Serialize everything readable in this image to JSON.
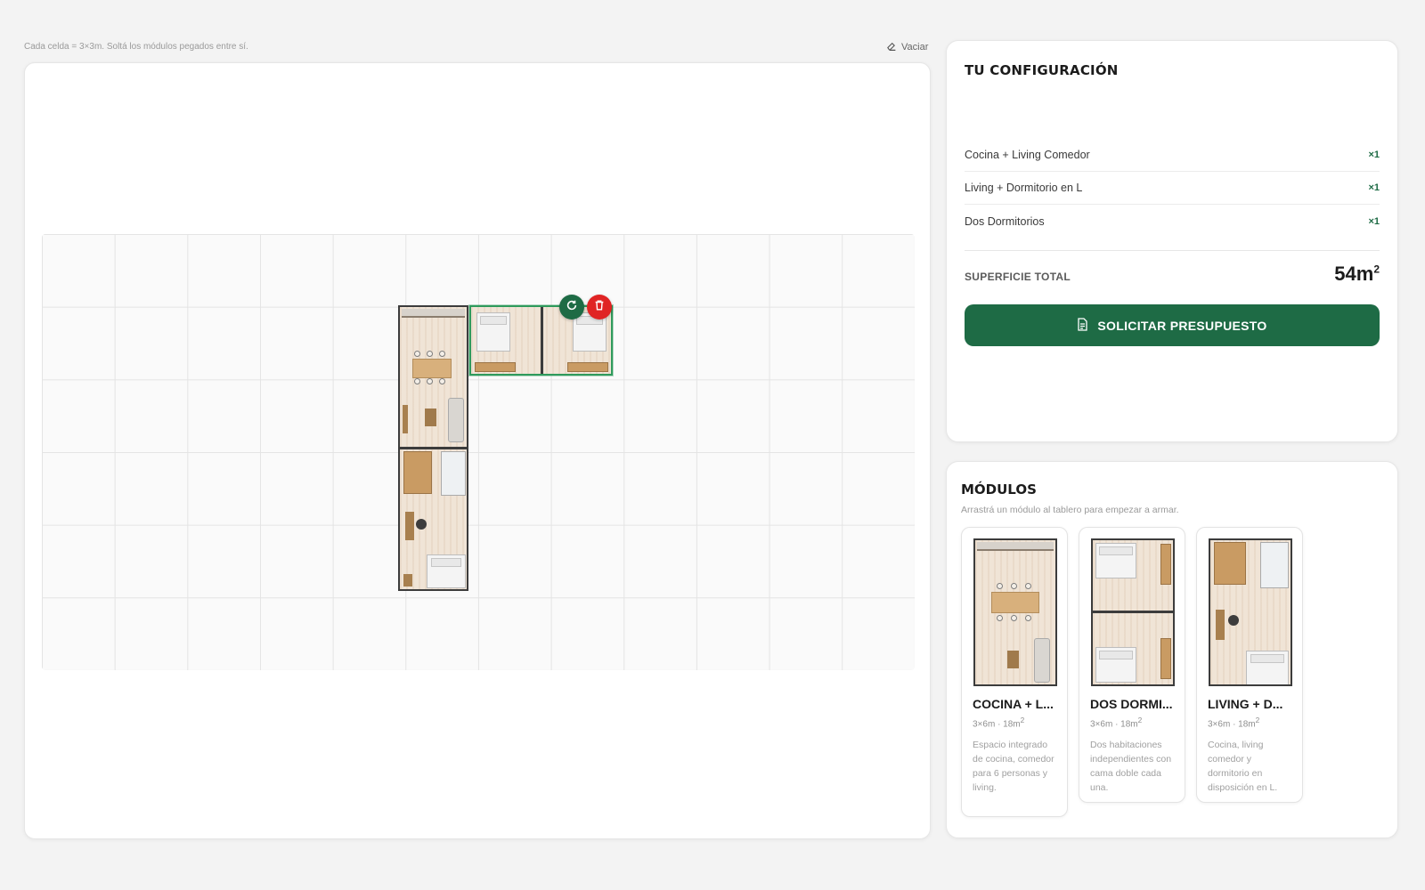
{
  "board": {
    "hint": "Cada celda = 3×3m. Soltá los módulos pegados entre sí.",
    "clear_label": "Vaciar"
  },
  "config": {
    "title": "TU CONFIGURACIÓN",
    "items": [
      {
        "name": "Cocina + Living Comedor",
        "qty": "×1"
      },
      {
        "name": "Living + Dormitorio en L",
        "qty": "×1"
      },
      {
        "name": "Dos Dormitorios",
        "qty": "×1"
      }
    ],
    "total_label": "SUPERFICIE TOTAL",
    "total_value": "54m",
    "total_unit_sup": "2",
    "quote_button": "SOLICITAR PRESUPUESTO"
  },
  "modules": {
    "title": "MÓDULOS",
    "subtitle": "Arrastrá un módulo al tablero para empezar a armar.",
    "items": [
      {
        "name": "COCINA + L...",
        "meta": "3×6m · 18m",
        "meta_sup": "2",
        "desc": "Espacio integrado de cocina, comedor para 6 personas y living."
      },
      {
        "name": "DOS DORMI...",
        "meta": "3×6m · 18m",
        "meta_sup": "2",
        "desc": "Dos habitaciones independientes con cama doble cada una."
      },
      {
        "name": "LIVING + D...",
        "meta": "3×6m · 18m",
        "meta_sup": "2",
        "desc": "Cocina, living comedor y dormitorio en disposición en L."
      }
    ]
  },
  "colors": {
    "accent": "#1e6b45",
    "danger": "#e02424",
    "selection": "#2f9a5c"
  },
  "icons": [
    "eraser-icon",
    "rotate-icon",
    "trash-icon",
    "document-icon"
  ]
}
